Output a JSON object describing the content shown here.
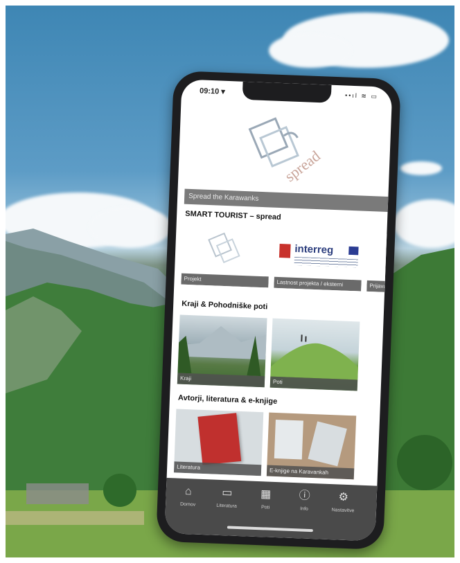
{
  "phone": {
    "status_time": "09:10 ▾",
    "status_icons": "••ıl ≋ ▭"
  },
  "app": {
    "logo_text": "spread",
    "banner_title": "Spread the Karawanks",
    "sections": [
      {
        "title": "SMART TOURIST – spread",
        "cards": [
          {
            "label": "Projekt",
            "image": "spread-logo"
          },
          {
            "label": "Lastnost projekta / eksterni",
            "image": "interreg-logo"
          },
          {
            "label": "Prijava",
            "image": "blank"
          }
        ]
      },
      {
        "title": "Kraji & Pohodniške poti",
        "cards": [
          {
            "label": "Kraji",
            "image": "mountain-photo"
          },
          {
            "label": "Poti",
            "image": "hill-photo"
          }
        ]
      },
      {
        "title": "Avtorji, literatura & e-knjige",
        "cards": [
          {
            "label": "Literatura",
            "image": "red-book"
          },
          {
            "label": "E-knjige na Karavankah",
            "image": "white-book"
          }
        ]
      }
    ],
    "interreg_logo_text": "interreg",
    "tabs": [
      {
        "label": "Domov",
        "icon": "home-icon"
      },
      {
        "label": "Literatura",
        "icon": "book-icon"
      },
      {
        "label": "Poti",
        "icon": "map-icon"
      },
      {
        "label": "Info",
        "icon": "info-icon"
      },
      {
        "label": "Nastavitve",
        "icon": "settings-icon"
      }
    ]
  }
}
